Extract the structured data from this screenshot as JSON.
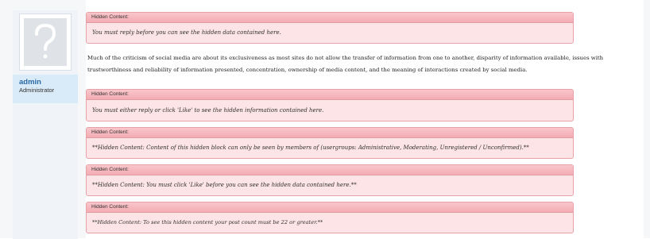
{
  "user": {
    "username": "admin",
    "title": "Administrator",
    "avatar_icon": "question-mark-icon"
  },
  "post": {
    "blocks": [
      {
        "header": "Hidden Content:",
        "text": "You must reply before you can see the hidden data contained here."
      },
      {
        "header": "Hidden Content:",
        "text": "You must either reply or click 'Like' to see the hidden information contained here."
      },
      {
        "header": "Hidden Content:",
        "text": "**Hidden Content: Content of this hidden block can only be seen by members of (usergroups: Administrative, Moderating, Unregistered / Unconfirmed).**"
      },
      {
        "header": "Hidden Content:",
        "text": "**Hidden Content: You must click 'Like' before you can see the hidden data contained here.**"
      },
      {
        "header": "Hidden Content:",
        "text": "**Hidden Content: To see this hidden content your post count must be 22 or greater.**"
      }
    ],
    "paragraph": "Much of the criticism of social media are about its exclusiveness as most sites do not allow the transfer of information from one to another, disparity of information available, issues with trustworthiness and reliability of information presented, concentration, ownership of media content, and the meaning of interactions created by social media."
  },
  "colors": {
    "hidden_bg": "#fde4e6",
    "hidden_border": "#e7a2a8",
    "hidden_header": "#f3adb3",
    "username": "#2b6aa8",
    "user_info_bg": "#d9ebf9"
  }
}
